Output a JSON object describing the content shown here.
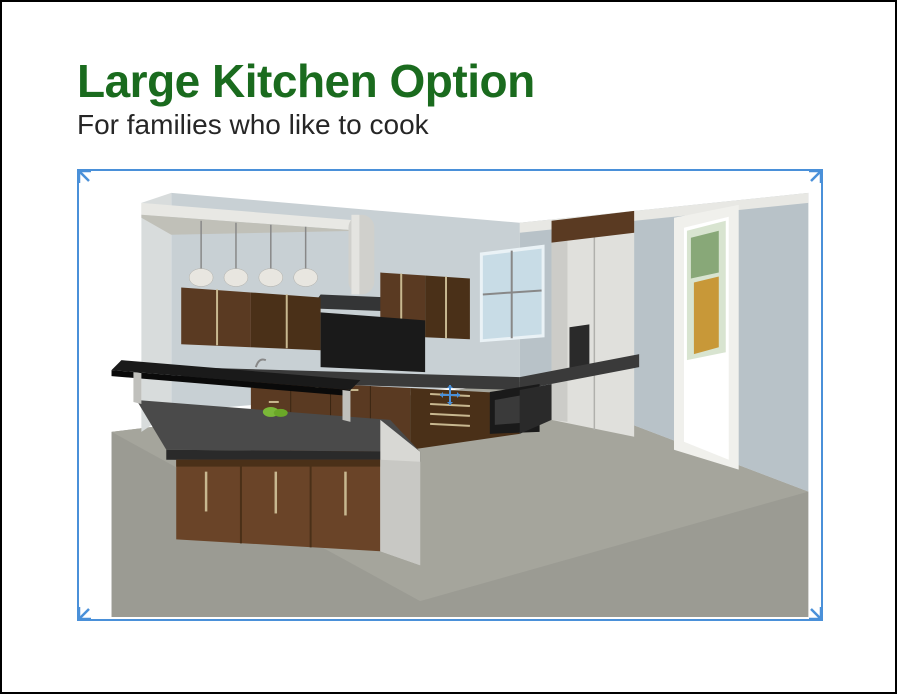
{
  "slide": {
    "title": "Large Kitchen Option",
    "subtitle": "For families who like to cook"
  },
  "selection": {
    "type": "image",
    "description": "3D kitchen rendering",
    "border_color": "#4a90d9"
  }
}
